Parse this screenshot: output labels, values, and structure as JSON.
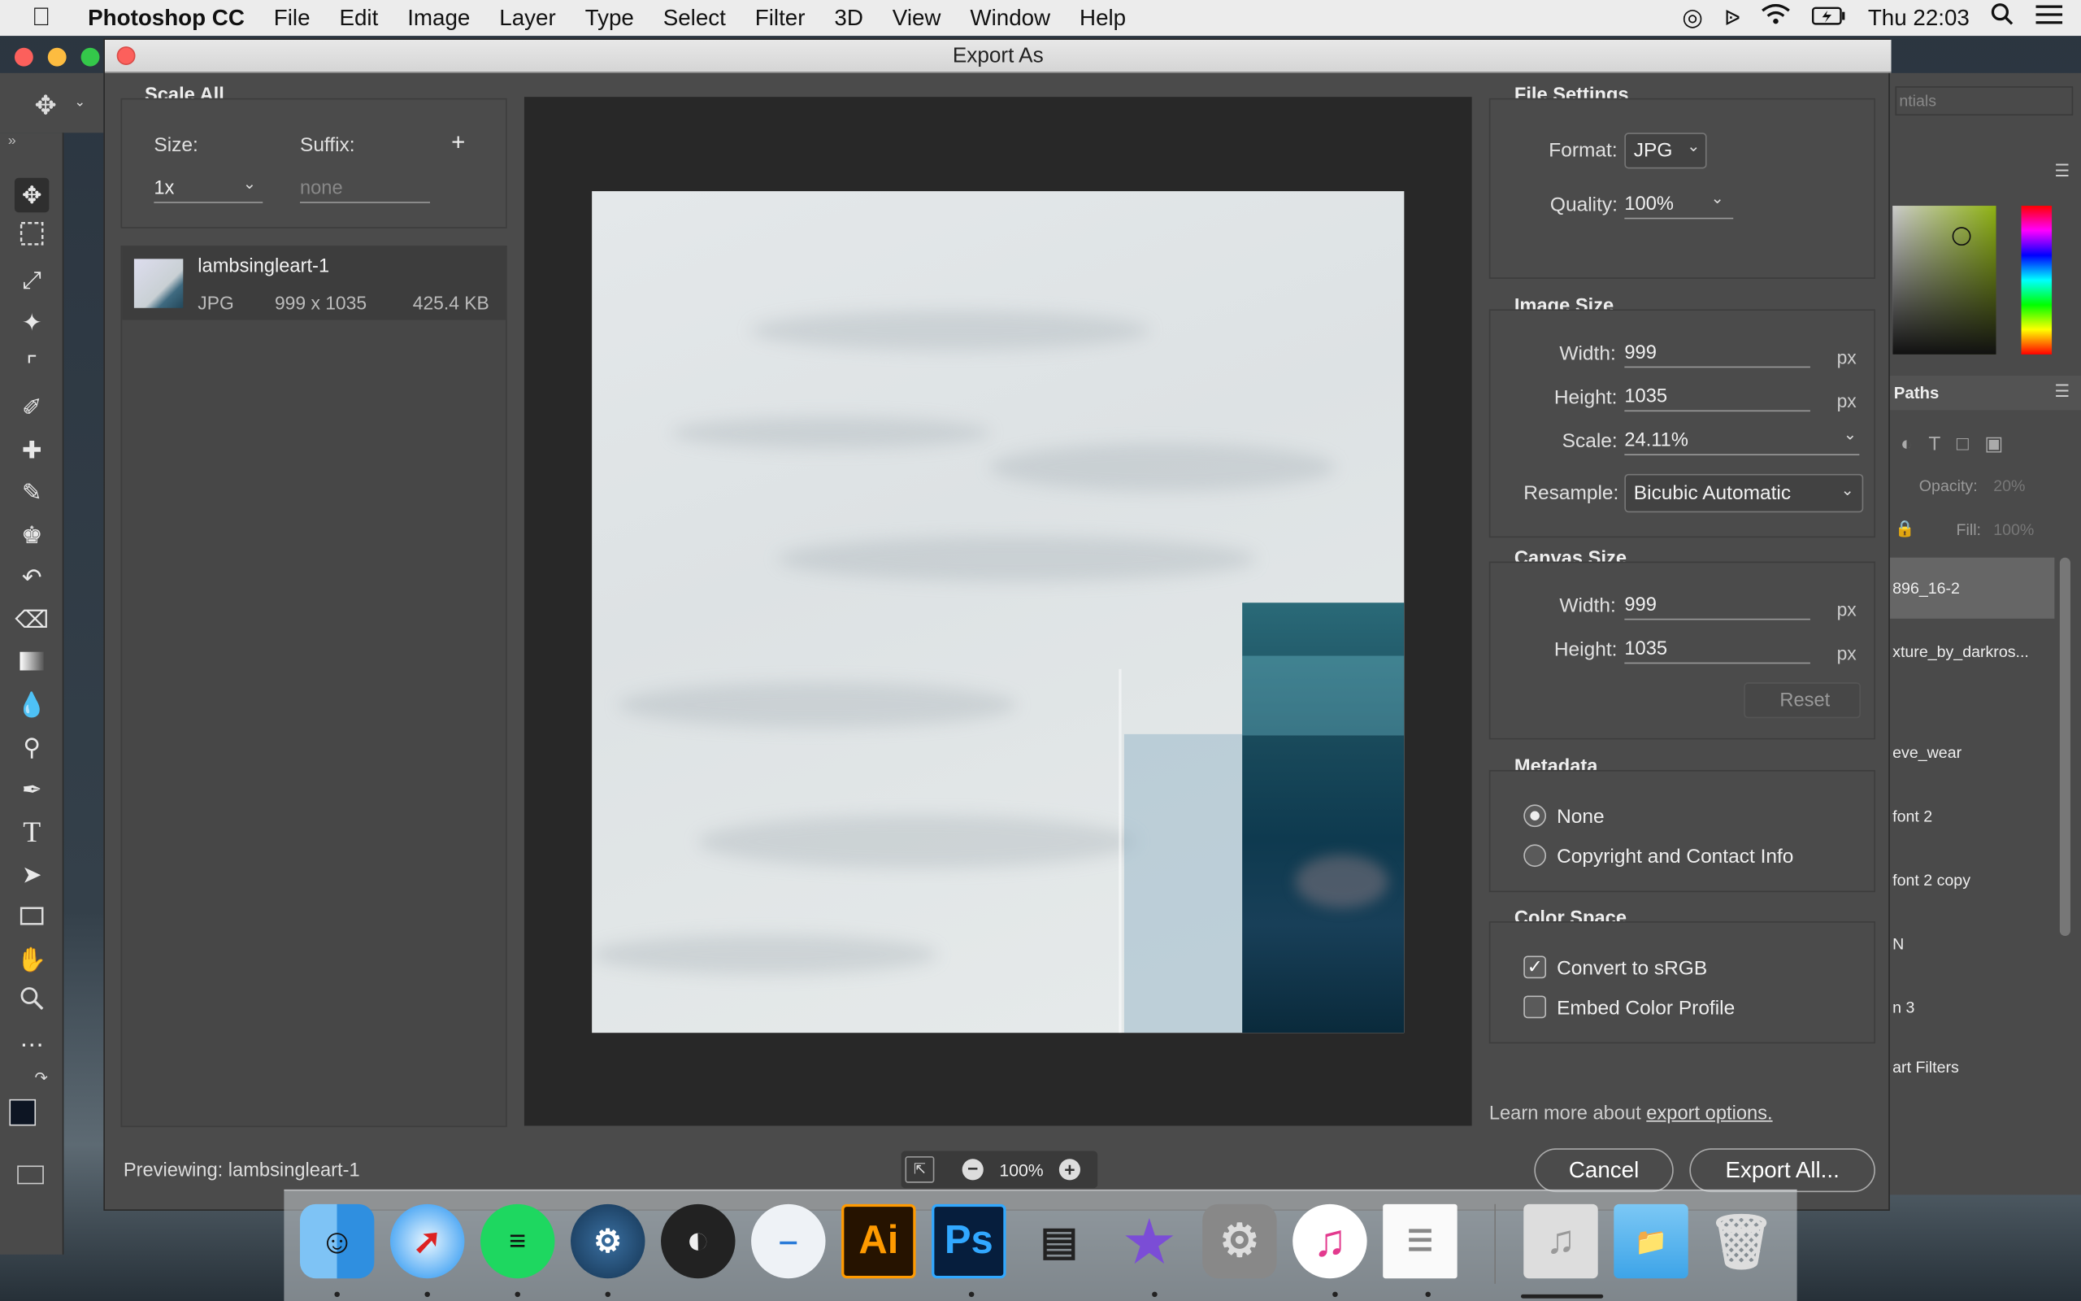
{
  "menubar": {
    "apple": "",
    "app": "Photoshop CC",
    "items": [
      "File",
      "Edit",
      "Image",
      "Layer",
      "Type",
      "Select",
      "Filter",
      "3D",
      "View",
      "Window",
      "Help"
    ],
    "clock": "Thu 22:03"
  },
  "dialog": {
    "title": "Export As",
    "scale_all": {
      "title": "Scale All",
      "size_label": "Size:",
      "suffix_label": "Suffix:",
      "add": "+",
      "size_value": "1x",
      "suffix_placeholder": "none"
    },
    "asset": {
      "name": "lambsingleart-1",
      "format": "JPG",
      "dimensions": "999 x 1035",
      "filesize": "425.4 KB"
    },
    "file_settings": {
      "title": "File Settings",
      "format_label": "Format:",
      "format_value": "JPG",
      "quality_label": "Quality:",
      "quality_value": "100%"
    },
    "image_size": {
      "title": "Image Size",
      "width_label": "Width:",
      "width_value": "999",
      "height_label": "Height:",
      "height_value": "1035",
      "scale_label": "Scale:",
      "scale_value": "24.11%",
      "resample_label": "Resample:",
      "resample_value": "Bicubic Automatic",
      "unit": "px"
    },
    "canvas_size": {
      "title": "Canvas Size",
      "width_label": "Width:",
      "width_value": "999",
      "height_label": "Height:",
      "height_value": "1035",
      "unit": "px",
      "reset": "Reset"
    },
    "metadata": {
      "title": "Metadata",
      "options": [
        "None",
        "Copyright and Contact Info"
      ],
      "selected": "None"
    },
    "color_space": {
      "title": "Color Space",
      "convert": "Convert to sRGB",
      "convert_checked": true,
      "embed": "Embed Color Profile",
      "embed_checked": false
    },
    "learn_more_prefix": "Learn more about ",
    "learn_more_link": "export options.",
    "previewing": "Previewing: lambsingleart-1",
    "zoom": "100%",
    "cancel": "Cancel",
    "export_all": "Export All..."
  },
  "psright": {
    "workspace": "ntials",
    "paths_tab": "Paths",
    "opacity_label": "Opacity:",
    "opacity_value": "20%",
    "fill_label": "Fill:",
    "fill_value": "100%",
    "layers": [
      "896_16-2",
      "xture_by_darkros...",
      "eve_wear",
      "font 2",
      "font 2 copy",
      "N",
      "n 3",
      "art Filters"
    ]
  },
  "dock": {
    "apps": [
      "Finder",
      "Safari",
      "Spotify",
      "Steam",
      "OBS",
      "Installer",
      "Ai",
      "Ps",
      "Scanner",
      "iMovie",
      "System Preferences",
      "iTunes",
      "TextEdit",
      "Music Folder",
      "Documents",
      "Trash"
    ]
  },
  "colors": {
    "accent_link": "#cfcfcf",
    "dialog_bg": "#4b4b4b",
    "preview_bg": "#282828"
  }
}
